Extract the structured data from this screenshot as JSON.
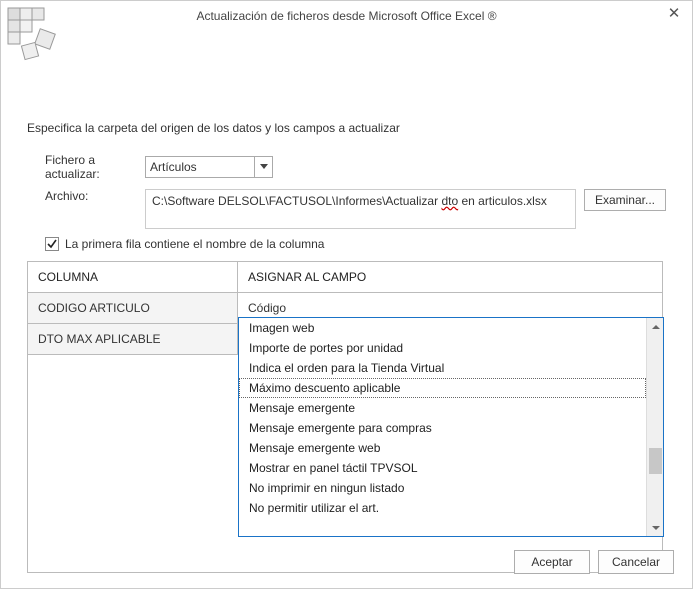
{
  "title": "Actualización de ficheros desde Microsoft Office Excel ®",
  "description": "Especifica la carpeta del origen de los datos y los campos a actualizar",
  "labels": {
    "file_to_update": "Fichero a actualizar:",
    "archive": "Archivo:",
    "browse": "Examinar...",
    "first_row_checkbox": "La primera fila contiene el nombre de la columna"
  },
  "file_select": {
    "value": "Artículos"
  },
  "archive_path": "C:\\Software DELSOL\\FACTUSOL\\Informes\\Actualizar dto en articulos.xlsx",
  "archive_path_parts": {
    "pre": "C:\\Software DELSOL\\FACTUSOL\\Informes\\Actualizar ",
    "err": "dto",
    "post": " en articulos.xlsx"
  },
  "first_row_checked": true,
  "grid": {
    "headers": {
      "col_a": "COLUMNA",
      "col_b": "ASIGNAR AL CAMPO"
    },
    "rows": [
      {
        "col_a": "CODIGO ARTICULO",
        "col_b": "Código"
      },
      {
        "col_a": "DTO MAX APLICABLE",
        "col_b": "Máximo descuento aplicable",
        "open": true
      }
    ]
  },
  "dropdown": {
    "items": [
      "Imagen web",
      "Importe de portes por unidad",
      "Indica el orden para la Tienda Virtual",
      "Máximo descuento aplicable",
      "Mensaje emergente",
      "Mensaje emergente para compras",
      "Mensaje emergente web",
      "Mostrar en panel táctil TPVSOL",
      "No imprimir en ningun listado",
      "No permitir utilizar el art."
    ],
    "focused_index": 3
  },
  "buttons": {
    "accept": "Aceptar",
    "cancel": "Cancelar"
  }
}
